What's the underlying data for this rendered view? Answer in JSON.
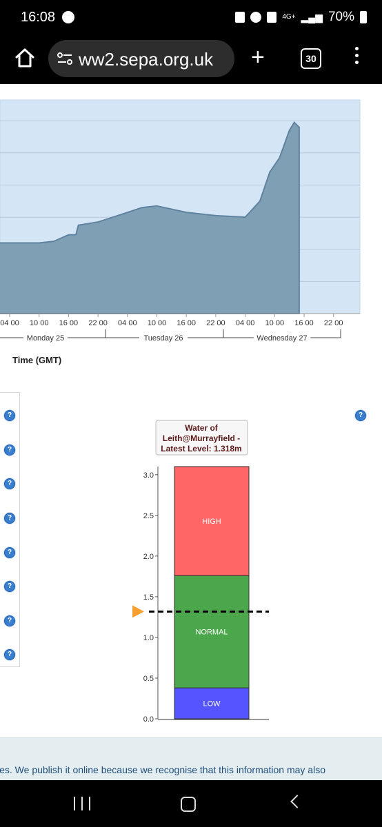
{
  "status": {
    "time": "16:08",
    "network": "4G+",
    "battery": "70%"
  },
  "browser": {
    "url": "ww2.sepa.org.uk",
    "tab_count": "30"
  },
  "chart_data": [
    {
      "type": "area",
      "xlabel": "Time (GMT)",
      "x_tick_labels": [
        "04 00",
        "10 00",
        "16 00",
        "22 00",
        "04 00",
        "10 00",
        "16 00",
        "22 00",
        "04 00",
        "10 00",
        "16 00",
        "22 00"
      ],
      "day_labels": [
        "Monday 25",
        "Tuesday 26",
        "Wednesday 27"
      ],
      "grid": true,
      "series": [
        {
          "color": "#7f9fb4",
          "x": [
            "Mon 04:00",
            "Mon 10:00",
            "Mon 13:00",
            "Mon 16:00",
            "Mon 17:30",
            "Mon 18:00",
            "Mon 22:00",
            "Tue 01:00",
            "Tue 04:00",
            "Tue 07:00",
            "Tue 10:00",
            "Tue 13:00",
            "Tue 16:00",
            "Tue 22:00",
            "Wed 04:00",
            "Wed 07:00",
            "Wed 09:00",
            "Wed 11:00",
            "Wed 13:00",
            "Wed 14:00",
            "Wed 15:00"
          ],
          "values": [
            0.44,
            0.44,
            0.45,
            0.49,
            0.49,
            0.55,
            0.57,
            0.6,
            0.63,
            0.66,
            0.67,
            0.65,
            0.63,
            0.61,
            0.6,
            0.7,
            0.88,
            0.97,
            1.14,
            1.19,
            1.16
          ]
        }
      ]
    },
    {
      "type": "bar",
      "title": "Water of Leith@Murrayfield - Latest Level: 1.318m",
      "title_lines": [
        "Water of",
        "Leith@Murrayfield -",
        "Latest Level: 1.318m"
      ],
      "y_tick_labels": [
        "3.0",
        "2.5",
        "2.0",
        "1.5",
        "1.0",
        "0.5",
        "0.0"
      ],
      "ylim": [
        0,
        3.1
      ],
      "bands": [
        {
          "label": "LOW",
          "from": 0.0,
          "to": 0.38,
          "color": "#5555ff"
        },
        {
          "label": "NORMAL",
          "from": 0.38,
          "to": 1.76,
          "color": "#4ca64c"
        },
        {
          "label": "HIGH",
          "from": 1.76,
          "to": 3.1,
          "color": "#ff6666"
        }
      ],
      "latest_level": 1.318,
      "marker_color": "#f7a030"
    }
  ],
  "footer": {
    "text": "ies. We publish it online because we recognise that this information may also"
  }
}
